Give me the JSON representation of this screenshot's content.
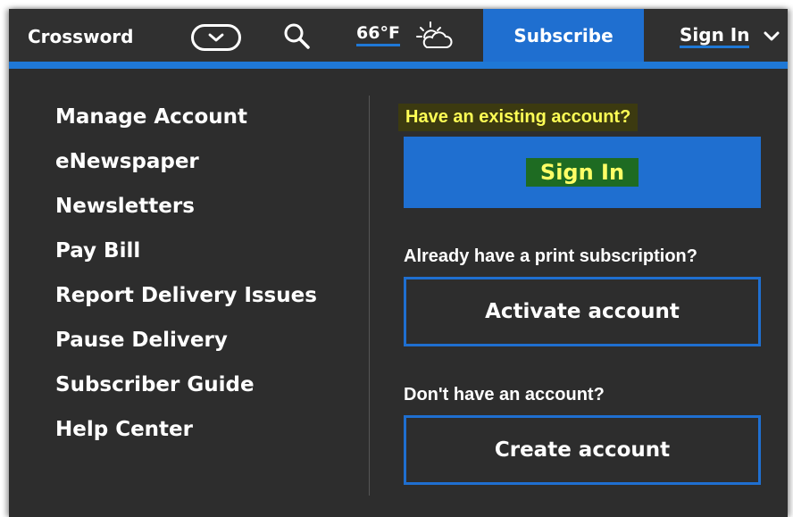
{
  "nav": {
    "crossword": "Crossword",
    "weather_temp": "66°F",
    "subscribe": "Subscribe",
    "sign_in": "Sign In"
  },
  "menu": {
    "items": [
      "Manage Account",
      "eNewspaper",
      "Newsletters",
      "Pay Bill",
      "Report Delivery Issues",
      "Pause Delivery",
      "Subscriber Guide",
      "Help Center"
    ]
  },
  "account_panel": {
    "existing_label": "Have an existing account?",
    "sign_in_button": "Sign In",
    "print_label": "Already have a print subscription?",
    "activate_button": "Activate account",
    "no_account_label": "Don't have an account?",
    "create_button": "Create account"
  },
  "colors": {
    "background": "#2d2d2d",
    "accent_blue": "#1f6fd0",
    "highlight_yellow": "#ffff55",
    "highlight_green": "#1e6b22"
  },
  "icons": {
    "dropdown": "chevron-down-icon",
    "search": "search-icon",
    "weather": "partly-cloudy-icon"
  }
}
